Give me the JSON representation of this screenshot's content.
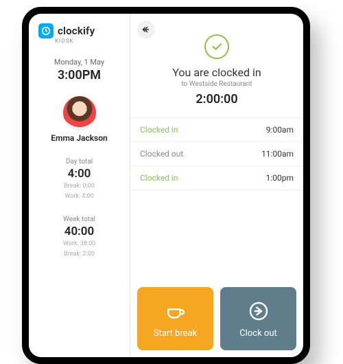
{
  "brand": {
    "name": "clockify",
    "sub": "KIOSK"
  },
  "sidebar": {
    "date": "Monday, 1 May",
    "time": "3:00PM",
    "user": "Emma Jackson",
    "day": {
      "label": "Day total",
      "value": "4:00",
      "break": "Break: 0:00",
      "work": "Work: 4:00"
    },
    "week": {
      "label": "Week total",
      "value": "40:00",
      "work": "Work: 38:00",
      "break": "Break: 2:00"
    }
  },
  "status": {
    "title": "You are clocked in",
    "sub": "to Westside Restaurant",
    "timer": "2:00:00"
  },
  "log": [
    {
      "label": "Clocked in",
      "type": "in",
      "time": "9:00am"
    },
    {
      "label": "Clocked out",
      "type": "out",
      "time": "11:00am"
    },
    {
      "label": "Clocked in",
      "type": "in",
      "time": "1:00pm"
    }
  ],
  "actions": {
    "break": "Start break",
    "clockout": "Clock out"
  },
  "colors": {
    "accent_green": "#8BC34A",
    "accent_orange": "#F5A623",
    "accent_slate": "#607D8B",
    "brand_blue": "#03A9F4"
  }
}
